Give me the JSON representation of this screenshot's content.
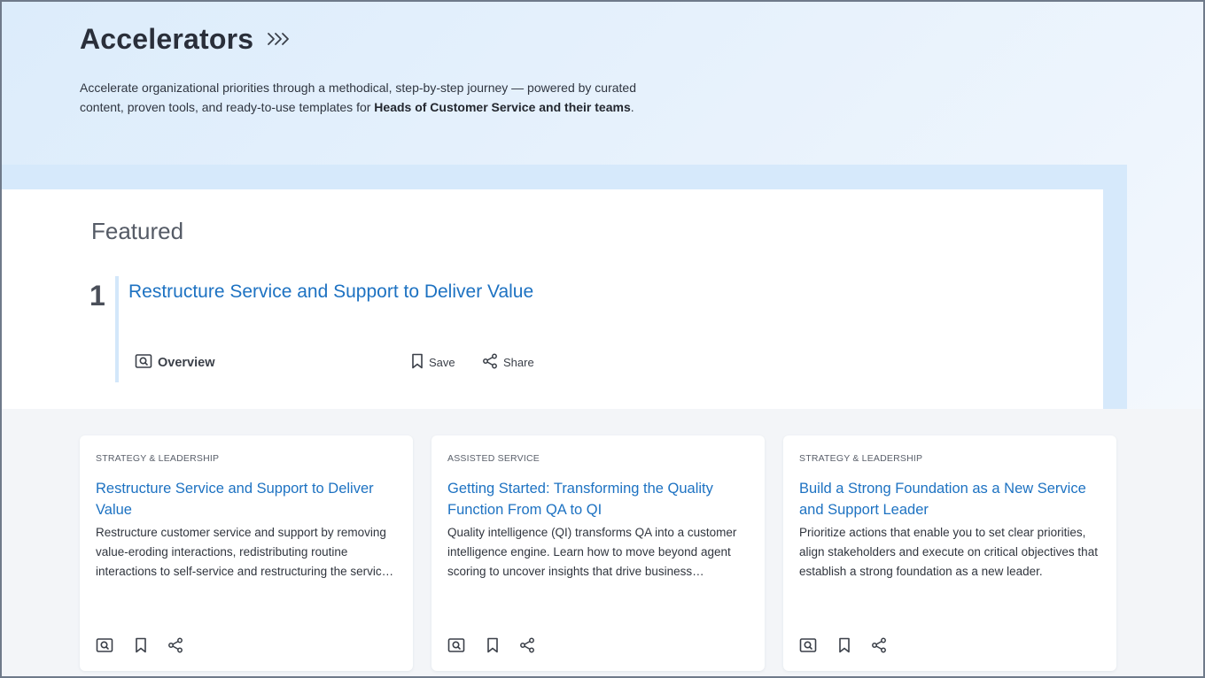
{
  "header": {
    "title": "Accelerators",
    "intro_part1": "Accelerate organizational priorities through a methodical, step-by-step journey — powered by curated content, proven tools, and ready-to-use templates for ",
    "intro_bold": "Heads of Customer Service and their teams",
    "intro_end": "."
  },
  "featured": {
    "section_label": "Featured",
    "number": "1",
    "title": "Restructure Service and Support to Deliver Value",
    "overview_label": "Overview",
    "save_label": "Save",
    "share_label": "Share"
  },
  "cards": [
    {
      "category": "STRATEGY & LEADERSHIP",
      "title": "Restructure Service and Support to Deliver Value",
      "description": "Restructure customer service and support by removing value-eroding interactions, redistributing routine interactions to self-service and restructuring the service and support organization to deliver value."
    },
    {
      "category": "ASSISTED SERVICE",
      "title": "Getting Started: Transforming the Quality Function From QA to QI",
      "description": "Quality intelligence (QI) transforms QA into a customer intelligence engine. Learn how to move beyond agent scoring to uncover insights that drive business improvement."
    },
    {
      "category": "STRATEGY & LEADERSHIP",
      "title": "Build a Strong Foundation as a New Service and Support Leader",
      "description": "Prioritize actions that enable you to set clear priorities, align stakeholders and execute on critical objectives that establish a strong foundation as a new leader."
    }
  ],
  "colors": {
    "accent_link": "#1d72c2",
    "hero_bg": "#dcecfb",
    "feature_bar": "#d3e7fa"
  },
  "icons": {
    "header": "triple-chevron-right-icon",
    "overview": "overview-magnifier-icon",
    "save": "bookmark-icon",
    "share": "share-icon"
  }
}
